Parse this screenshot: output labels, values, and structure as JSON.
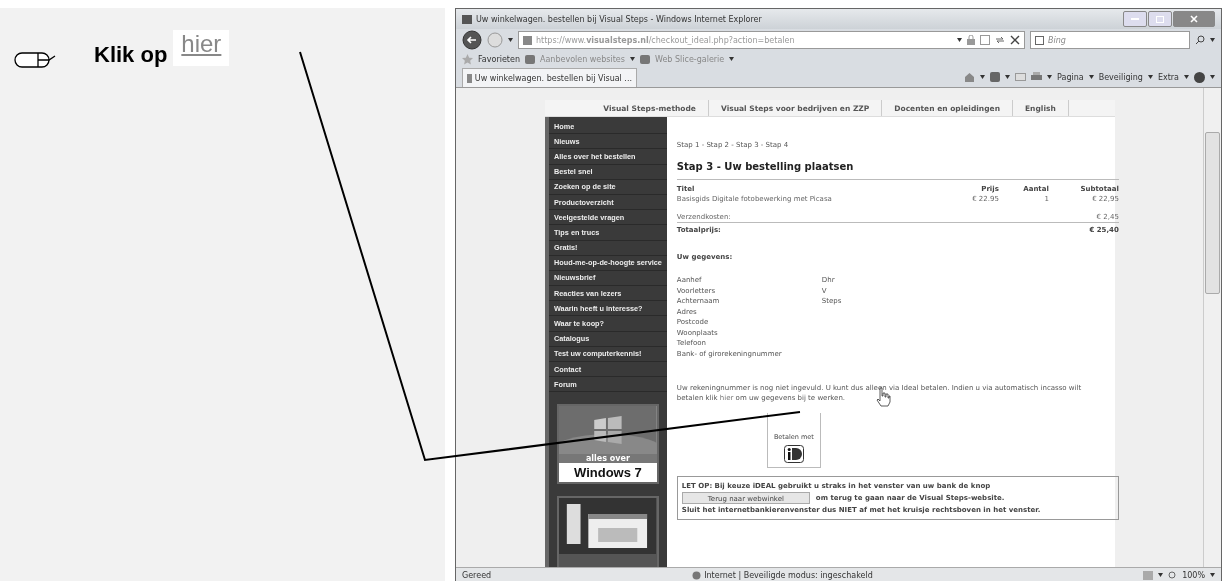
{
  "instruction": {
    "text": "Klik op",
    "link": "hier"
  },
  "browser": {
    "title": "Uw winkelwagen. bestellen bij Visual Steps - Windows Internet Explorer",
    "address": "https://www.**visualsteps.nl**/checkout_ideal.php?action=betalen",
    "search_placeholder": "Bing",
    "favorites": [
      "Favorieten",
      "Aanbevolen websites",
      "Web Slice-galerie"
    ],
    "tab": "Uw winkelwagen. bestellen bij Visual ...",
    "commands": [
      "Pagina",
      "Beveiliging",
      "Extra"
    ],
    "status": {
      "left": "Gereed",
      "zone": "Internet | Beveiligde modus: ingeschakeld",
      "zoom": "100%"
    }
  },
  "site": {
    "nav": [
      "Visual Steps-methode",
      "Visual Steps voor bedrijven en ZZP",
      "Docenten en opleidingen",
      "English"
    ],
    "sidebar": [
      "Home",
      "Nieuws",
      "Alles over het bestellen",
      "Bestel snel",
      "Zoeken op de site",
      "Productoverzicht",
      "Veelgestelde vragen",
      "Tips en trucs",
      "Gratis!",
      "Houd-me-op-de-hoogte service",
      "Nieuwsbrief",
      "Reacties van lezers",
      "Waarin heeft u interesse?",
      "Waar te koop?",
      "Catalogus",
      "Test uw computerkennis!",
      "Contact",
      "Forum"
    ],
    "promo": {
      "band": "alles over",
      "title": "Windows 7"
    },
    "steps": "Stap 1 - Stap 2 - Stap 3 - Stap 4",
    "heading": "Stap 3 - Uw bestelling plaatsen",
    "table": {
      "columns": [
        "Titel",
        "Prijs",
        "Aantal",
        "Subtotaal"
      ],
      "rows": [
        [
          "Basisgids Digitale fotobewerking met Picasa",
          "€ 22.95",
          "1",
          "€ 22,95"
        ]
      ],
      "shipping": {
        "label": "Verzendkosten:",
        "value": "€ 2,45"
      },
      "total": {
        "label": "Totaalprijs:",
        "value": "€ 25,40"
      }
    },
    "details_title": "Uw gegevens:",
    "details": [
      {
        "label": "Aanhef",
        "value": "Dhr"
      },
      {
        "label": "Voorletters",
        "value": "V"
      },
      {
        "label": "Achternaam",
        "value": "Steps"
      },
      {
        "label": "Adres"
      },
      {
        "label": "Postcode"
      },
      {
        "label": "Woonplaats"
      },
      {
        "label": "Telefoon"
      },
      {
        "label": "Bank- of girorekeningnummer"
      }
    ],
    "message": "Uw rekeningnummer is nog niet ingevuld. U kunt dus alleen via Ideal betalen. Indien u via automatisch incasso wilt betalen klik",
    "message_link": "hier",
    "message_end": "om uw gegevens bij te werken.",
    "pay_label": "Betalen met",
    "notice": {
      "line1": "LET OP: Bij keuze iDEAL gebruikt u straks in het venster van uw bank de knop",
      "button": "Terug naar webwinkel",
      "line2": "om terug te gaan naar de Visual Steps-website.",
      "line3": "Sluit het internetbankierenvenster dus NIET af met het kruisje rechtsboven in het venster."
    }
  }
}
